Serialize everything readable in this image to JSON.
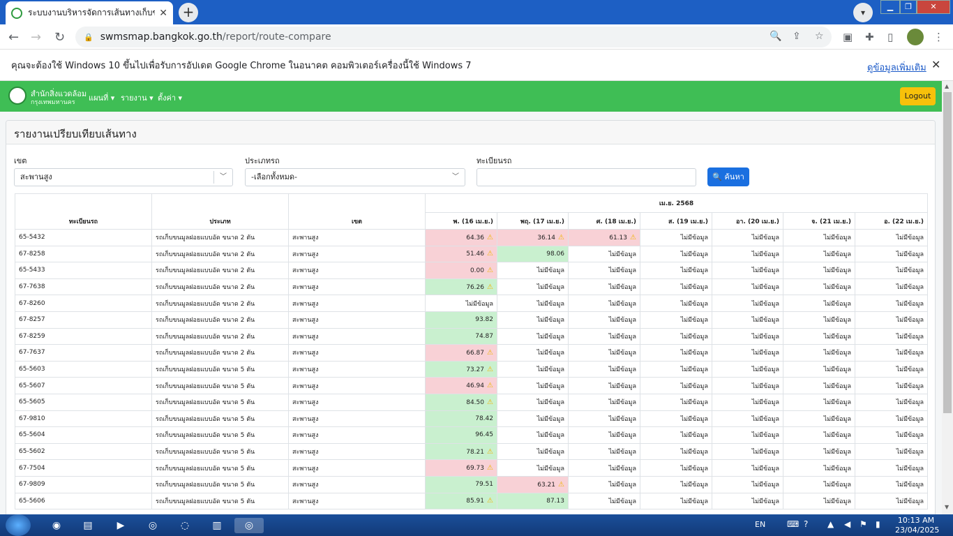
{
  "browser": {
    "tab_title": "ระบบงานบริหารจัดการเส้นทางเก็บขนมู",
    "url_host": "swmsmap.bangkok.go.th",
    "url_path": "/report/route-compare",
    "info_text": "คุณจะต้องใช้ Windows 10 ขึ้นไปเพื่อรับการอัปเดต Google Chrome ในอนาคต คอมพิวเตอร์เครื่องนี้ใช้ Windows 7",
    "info_link": "ดูข้อมูลเพิ่มเติม"
  },
  "navbar": {
    "brand_line1": "สำนักสิ่งแวดล้อม",
    "brand_line2": "กรุงเทพมหานคร",
    "menu": [
      "แผนที่",
      "รายงาน",
      "ตั้งค่า"
    ],
    "logout": "Logout",
    "accent": "#3fbe55"
  },
  "card": {
    "title": "รายงานเปรียบเทียบเส้นทาง"
  },
  "filters": {
    "district_label": "เขต",
    "district_value": "สะพานสูง",
    "type_label": "ประเภทรถ",
    "type_value": "-เลือกทั้งหมด-",
    "plate_label": "ทะเบียนรถ",
    "plate_value": "",
    "search_button": "ค้นหา"
  },
  "table": {
    "headers": {
      "plate": "ทะเบียนรถ",
      "type": "ประเภท",
      "district": "เขต",
      "month": "เม.ย. 2568"
    },
    "days": [
      "พ. (16 เม.ย.)",
      "พฤ. (17 เม.ย.)",
      "ศ. (18 เม.ย.)",
      "ส. (19 เม.ย.)",
      "อา. (20 เม.ย.)",
      "จ. (21 เม.ย.)",
      "อ. (22 เม.ย.)"
    ],
    "no_data": "ไม่มีข้อมูล",
    "rows": [
      {
        "plate": "65-5432",
        "type": "รถเก็บขนมูลฝอยแบบอัด ขนาด 2 ตัน",
        "district": "สะพานสูง",
        "cells": [
          {
            "v": "64.36",
            "s": "red",
            "w": true
          },
          {
            "v": "36.14",
            "s": "red",
            "w": true
          },
          {
            "v": "61.13",
            "s": "red",
            "w": true
          },
          null,
          null,
          null,
          null
        ]
      },
      {
        "plate": "67-8258",
        "type": "รถเก็บขนมูลฝอยแบบอัด ขนาด 2 ตัน",
        "district": "สะพานสูง",
        "cells": [
          {
            "v": "51.46",
            "s": "red",
            "w": true
          },
          {
            "v": "98.06",
            "s": "grn",
            "w": false
          },
          null,
          null,
          null,
          null,
          null
        ]
      },
      {
        "plate": "65-5433",
        "type": "รถเก็บขนมูลฝอยแบบอัด ขนาด 2 ตัน",
        "district": "สะพานสูง",
        "cells": [
          {
            "v": "0.00",
            "s": "red",
            "w": true
          },
          null,
          null,
          null,
          null,
          null,
          null
        ]
      },
      {
        "plate": "67-7638",
        "type": "รถเก็บขนมูลฝอยแบบอัด ขนาด 2 ตัน",
        "district": "สะพานสูง",
        "cells": [
          {
            "v": "76.26",
            "s": "grn",
            "w": true
          },
          null,
          null,
          null,
          null,
          null,
          null
        ]
      },
      {
        "plate": "67-8260",
        "type": "รถเก็บขนมูลฝอยแบบอัด ขนาด 2 ตัน",
        "district": "สะพานสูง",
        "cells": [
          null,
          null,
          null,
          null,
          null,
          null,
          null
        ]
      },
      {
        "plate": "67-8257",
        "type": "รถเก็บขนมูลฝอยแบบอัด ขนาด 2 ตัน",
        "district": "สะพานสูง",
        "cells": [
          {
            "v": "93.82",
            "s": "grn",
            "w": false
          },
          null,
          null,
          null,
          null,
          null,
          null
        ]
      },
      {
        "plate": "67-8259",
        "type": "รถเก็บขนมูลฝอยแบบอัด ขนาด 2 ตัน",
        "district": "สะพานสูง",
        "cells": [
          {
            "v": "74.87",
            "s": "grn",
            "w": false
          },
          null,
          null,
          null,
          null,
          null,
          null
        ]
      },
      {
        "plate": "67-7637",
        "type": "รถเก็บขนมูลฝอยแบบอัด ขนาด 2 ตัน",
        "district": "สะพานสูง",
        "cells": [
          {
            "v": "66.87",
            "s": "red",
            "w": true
          },
          null,
          null,
          null,
          null,
          null,
          null
        ]
      },
      {
        "plate": "65-5603",
        "type": "รถเก็บขนมูลฝอยแบบอัด ขนาด 5 ตัน",
        "district": "สะพานสูง",
        "cells": [
          {
            "v": "73.27",
            "s": "grn",
            "w": true
          },
          null,
          null,
          null,
          null,
          null,
          null
        ]
      },
      {
        "plate": "65-5607",
        "type": "รถเก็บขนมูลฝอยแบบอัด ขนาด 5 ตัน",
        "district": "สะพานสูง",
        "cells": [
          {
            "v": "46.94",
            "s": "red",
            "w": true
          },
          null,
          null,
          null,
          null,
          null,
          null
        ]
      },
      {
        "plate": "65-5605",
        "type": "รถเก็บขนมูลฝอยแบบอัด ขนาด 5 ตัน",
        "district": "สะพานสูง",
        "cells": [
          {
            "v": "84.50",
            "s": "grn",
            "w": true
          },
          null,
          null,
          null,
          null,
          null,
          null
        ]
      },
      {
        "plate": "67-9810",
        "type": "รถเก็บขนมูลฝอยแบบอัด ขนาด 5 ตัน",
        "district": "สะพานสูง",
        "cells": [
          {
            "v": "78.42",
            "s": "grn",
            "w": false
          },
          null,
          null,
          null,
          null,
          null,
          null
        ]
      },
      {
        "plate": "65-5604",
        "type": "รถเก็บขนมูลฝอยแบบอัด ขนาด 5 ตัน",
        "district": "สะพานสูง",
        "cells": [
          {
            "v": "96.45",
            "s": "grn",
            "w": false
          },
          null,
          null,
          null,
          null,
          null,
          null
        ]
      },
      {
        "plate": "65-5602",
        "type": "รถเก็บขนมูลฝอยแบบอัด ขนาด 5 ตัน",
        "district": "สะพานสูง",
        "cells": [
          {
            "v": "78.21",
            "s": "grn",
            "w": true
          },
          null,
          null,
          null,
          null,
          null,
          null
        ]
      },
      {
        "plate": "67-7504",
        "type": "รถเก็บขนมูลฝอยแบบอัด ขนาด 5 ตัน",
        "district": "สะพานสูง",
        "cells": [
          {
            "v": "69.73",
            "s": "red",
            "w": true
          },
          null,
          null,
          null,
          null,
          null,
          null
        ]
      },
      {
        "plate": "67-9809",
        "type": "รถเก็บขนมูลฝอยแบบอัด ขนาด 5 ตัน",
        "district": "สะพานสูง",
        "cells": [
          {
            "v": "79.51",
            "s": "grn",
            "w": false
          },
          {
            "v": "63.21",
            "s": "red",
            "w": true
          },
          null,
          null,
          null,
          null,
          null
        ]
      },
      {
        "plate": "65-5606",
        "type": "รถเก็บขนมูลฝอยแบบอัด ขนาด 5 ตัน",
        "district": "สะพานสูง",
        "cells": [
          {
            "v": "85.91",
            "s": "grn",
            "w": true
          },
          {
            "v": "87.13",
            "s": "grn",
            "w": false
          },
          null,
          null,
          null,
          null,
          null
        ]
      }
    ]
  },
  "taskbar": {
    "lang": "EN",
    "time": "10:13 AM",
    "date": "23/04/2025"
  }
}
